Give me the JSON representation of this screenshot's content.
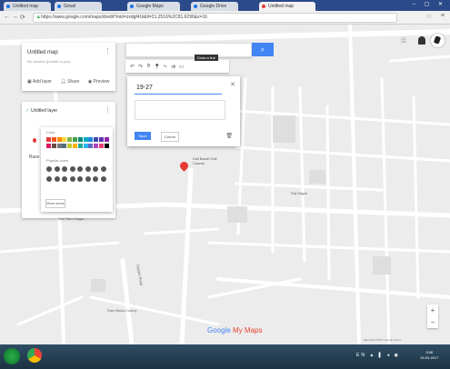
{
  "browser": {
    "tabs": [
      {
        "label": "Untitled map"
      },
      {
        "label": "Gmail"
      },
      {
        "label": "Google Maps"
      },
      {
        "label": "Google Drive"
      },
      {
        "label": "Untitled map"
      }
    ],
    "url": "https://www.google.com/maps/d/edit?mid=zxdgf4Ui&ll=21.2516%2C81.6296&z=16"
  },
  "search": {
    "placeholder": "",
    "button_icon": "search-icon"
  },
  "toolbar": {
    "icons": [
      "undo-icon",
      "redo-icon",
      "hand-icon",
      "marker-icon",
      "line-icon",
      "route-icon",
      "ruler-icon"
    ],
    "tooltip": "Draw a line"
  },
  "panel": {
    "title": "Untitled map",
    "subtitle": "No viewers (private to you)",
    "actions": [
      "Add layer",
      "Share",
      "Preview"
    ]
  },
  "layer": {
    "title": "Untitled layer",
    "base_label": "Base map"
  },
  "color_popup": {
    "color_label": "Color",
    "icon_label": "Popular icons",
    "more_label": "More icons",
    "colors": [
      "#e53935",
      "#f4511e",
      "#fb8c00",
      "#fdd835",
      "#7cb342",
      "#43a047",
      "#00897b",
      "#00acc1",
      "#1e88e5",
      "#3949ab",
      "#5e35b1",
      "#8e24aa",
      "#d81b60",
      "#6d4c41",
      "#757575",
      "#546e7a",
      "#c0ca33",
      "#ffb300",
      "#26a69a",
      "#29b6f6",
      "#5c6bc0",
      "#ab47bc",
      "#ec407a",
      "#000000"
    ]
  },
  "dialog": {
    "title_value": "19-27",
    "save_label": "Save",
    "cancel_label": "Cancel"
  },
  "marker": {
    "label": "Kali Bandi Golf Course"
  },
  "map_labels": [
    {
      "text": "Shri Ram Nagar"
    },
    {
      "text": "Ram Baba Colony"
    },
    {
      "text": "Raj Nagar"
    },
    {
      "text": "Gayatri Road"
    }
  ],
  "footer": {
    "logo_g": "Google",
    "logo_suffix": "My Maps",
    "copyright": "Map data ©2017 Google   Terms"
  },
  "taskbar": {
    "tray": "EN ▲ ▌ ◂ ◉",
    "time": "3:58",
    "date": "19-03-2017"
  }
}
